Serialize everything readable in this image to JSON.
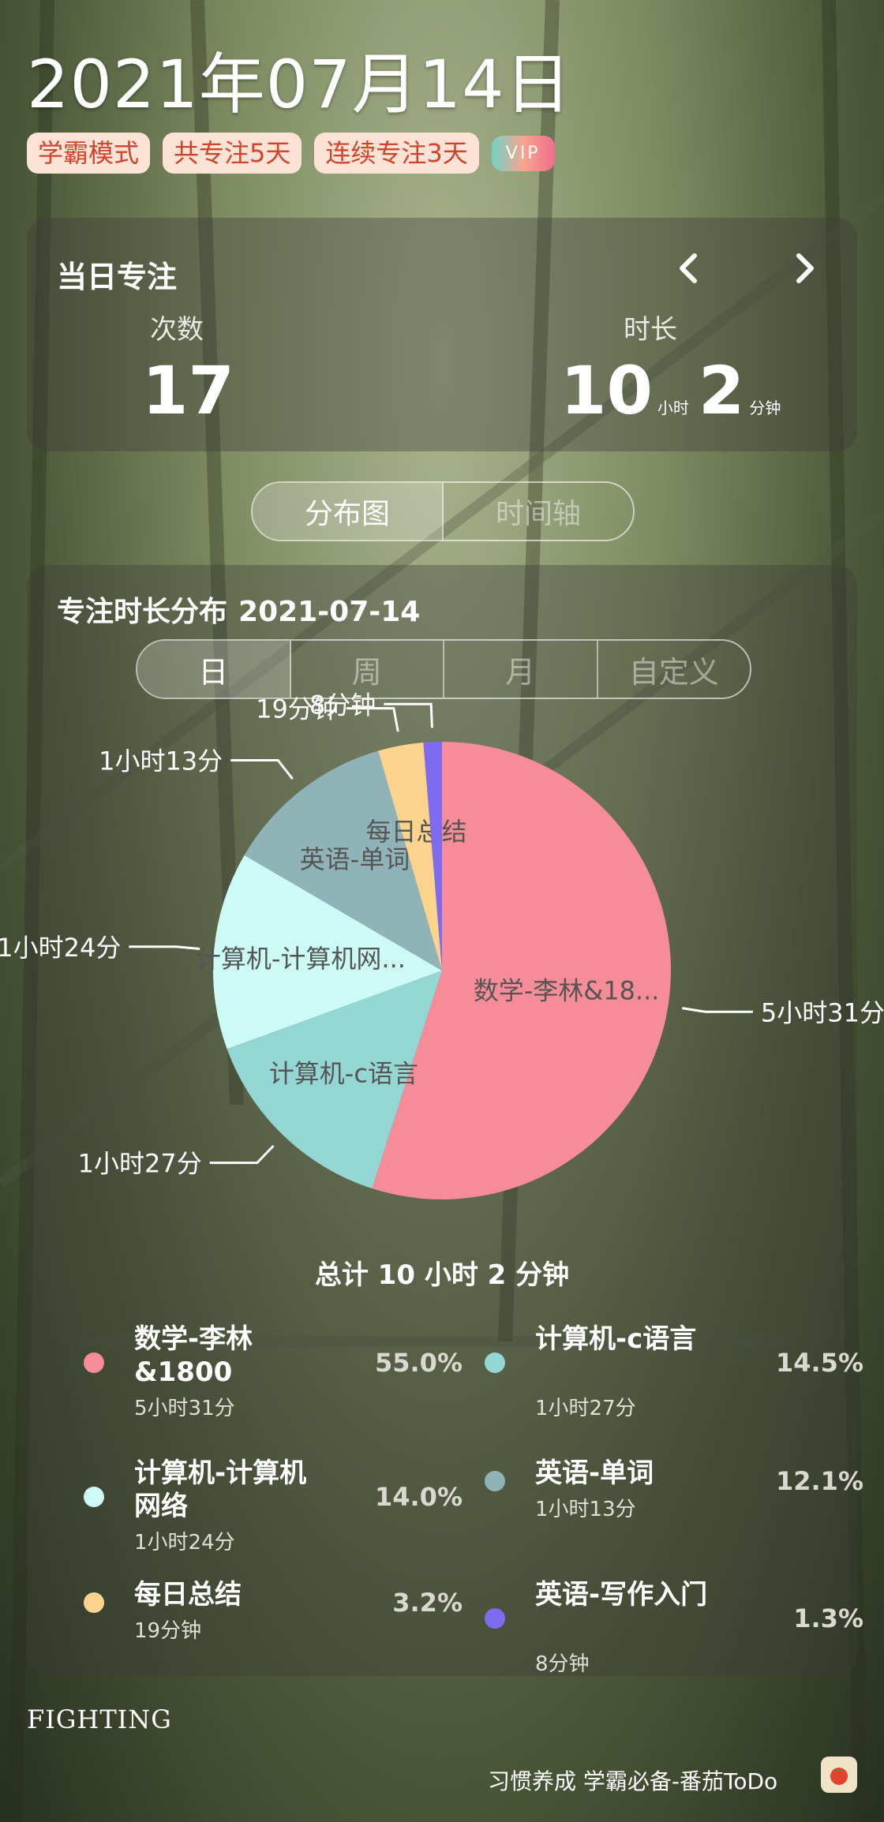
{
  "header": {
    "date": "2021年07月14日",
    "tags": [
      "学霸模式",
      "共专注5天",
      "连续专注3天"
    ],
    "vip": "VIP"
  },
  "daily": {
    "title": "当日专注",
    "count_label": "次数",
    "count_value": "17",
    "duration_label": "时长",
    "hours": "10",
    "hours_unit": "小时",
    "minutes": "2",
    "minutes_unit": "分钟"
  },
  "view_tabs": [
    {
      "label": "分布图",
      "active": true
    },
    {
      "label": "时间轴",
      "active": false
    }
  ],
  "distribution": {
    "title": "专注时长分布",
    "date": "2021-07-14",
    "range_tabs": [
      {
        "label": "日",
        "active": true
      },
      {
        "label": "周",
        "active": false
      },
      {
        "label": "月",
        "active": false
      },
      {
        "label": "自定义",
        "active": false
      }
    ],
    "total": "总计 10 小时 2 分钟"
  },
  "chart_data": {
    "type": "pie",
    "slices": [
      {
        "name": "数学-李林&1800",
        "label": "数学-李林&18...",
        "duration": "5小时31分",
        "percent": 55.0,
        "color": "#f58c97"
      },
      {
        "name": "计算机-c语言",
        "label": "计算机-c语言",
        "duration": "1小时27分",
        "percent": 14.5,
        "color": "#93d6d4"
      },
      {
        "name": "计算机-计算机网络",
        "label": "计算机-计算机网...",
        "duration": "1小时24分",
        "percent": 14.0,
        "color": "#ccfaf4"
      },
      {
        "name": "英语-单词",
        "label": "英语-单词",
        "duration": "1小时13分",
        "percent": 12.1,
        "color": "#8fb3b7"
      },
      {
        "name": "每日总结",
        "label": "每日总结",
        "duration": "19分钟",
        "percent": 3.2,
        "color": "#fcd38c"
      },
      {
        "name": "英语-写作入门",
        "label": "",
        "duration": "8分钟",
        "percent": 1.3,
        "color": "#7e6bef"
      }
    ]
  },
  "legend": [
    {
      "name": "数学-李林&1800",
      "sub": "5小时31分",
      "pct": "55.0%",
      "color": "#f58c97"
    },
    {
      "name": "计算机-c语言",
      "sub": "1小时27分",
      "pct": "14.5%",
      "color": "#93d6d4"
    },
    {
      "name": "计算机-计算机网络",
      "sub": "1小时24分",
      "pct": "14.0%",
      "color": "#ccfaf4"
    },
    {
      "name": "英语-单词",
      "sub": "1小时13分",
      "pct": "12.1%",
      "color": "#8fb3b7"
    },
    {
      "name": "每日总结",
      "sub": "19分钟",
      "pct": "3.2%",
      "color": "#fcd38c"
    },
    {
      "name": "英语-写作入门",
      "sub": "8分钟",
      "pct": "1.3%",
      "color": "#7e6bef"
    }
  ],
  "footer": {
    "motto": "FIGHTING",
    "slogan": "习惯养成 学霸必备-番茄ToDo"
  }
}
